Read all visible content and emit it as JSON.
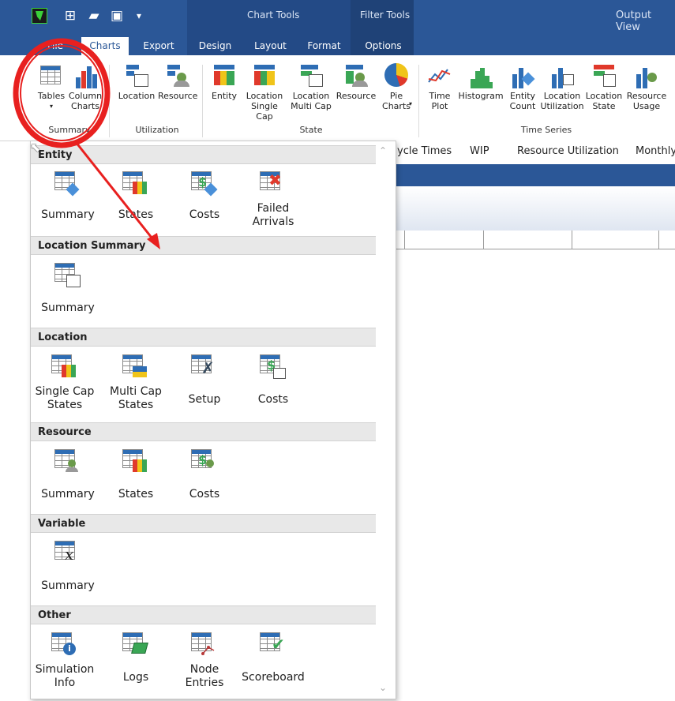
{
  "titlebar": {
    "context_chart_tools": "Chart Tools",
    "context_filter_tools": "Filter Tools",
    "output_view": "Output View"
  },
  "tabs": [
    "File",
    "Charts",
    "Export",
    "Design",
    "Layout",
    "Format",
    "Options"
  ],
  "active_tab": "Charts",
  "ribbon": {
    "summary_group": {
      "label": "Summary",
      "buttons": [
        "Tables",
        "Column Charts"
      ]
    },
    "utilization_group": {
      "label": "Utilization",
      "buttons": [
        "Location",
        "Resource"
      ]
    },
    "state_group": {
      "label": "State",
      "buttons": [
        "Entity",
        "Location Single Cap",
        "Location Multi Cap",
        "Resource",
        "Pie Charts"
      ]
    },
    "time_series_group": {
      "label": "Time Series",
      "buttons": [
        "Time Plot",
        "Histogram",
        "Entity Count",
        "Location Utilization",
        "Location State",
        "Resource Usage"
      ]
    }
  },
  "view_tabs": [
    "ycle Times",
    "WIP",
    "Resource Utilization",
    "Monthly"
  ],
  "dropdown": {
    "sections": [
      {
        "title": "Entity",
        "items": [
          "Summary",
          "States",
          "Costs",
          "Failed Arrivals"
        ]
      },
      {
        "title": "Location Summary",
        "items": [
          "Summary"
        ]
      },
      {
        "title": "Location",
        "items": [
          "Single Cap States",
          "Multi Cap States",
          "Setup",
          "Costs"
        ]
      },
      {
        "title": "Resource",
        "items": [
          "Summary",
          "States",
          "Costs"
        ]
      },
      {
        "title": "Variable",
        "items": [
          "Summary"
        ]
      },
      {
        "title": "Other",
        "items": [
          "Simulation Info",
          "Logs",
          "Node Entries",
          "Scoreboard"
        ]
      }
    ]
  },
  "colors": {
    "accent": "#2b5797",
    "annotation": "#e8201f"
  }
}
